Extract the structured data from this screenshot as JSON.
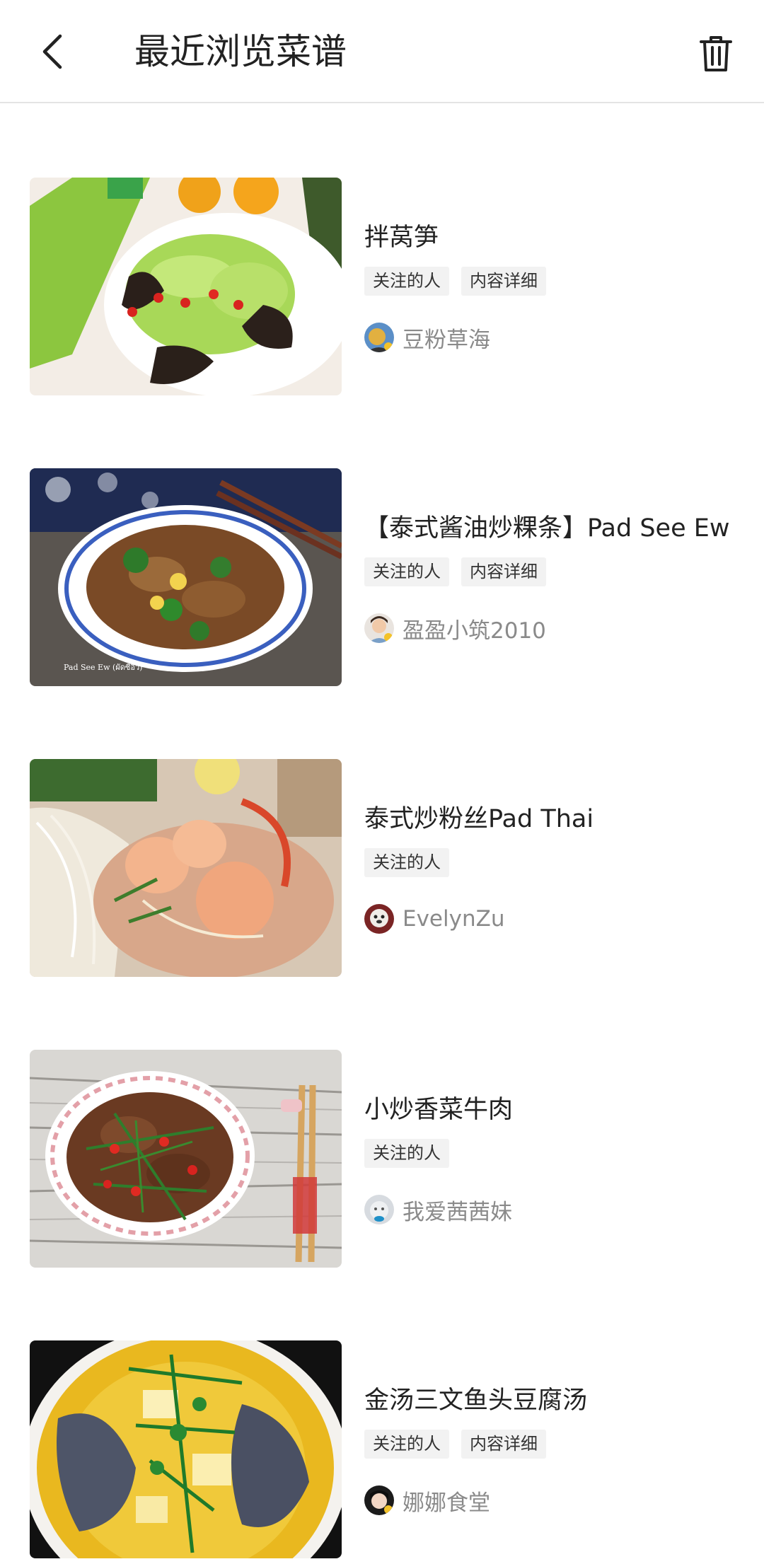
{
  "header": {
    "title": "最近浏览菜谱",
    "back_icon": "chevron-left-icon",
    "delete_icon": "trash-icon"
  },
  "recipes": [
    {
      "name": "拌莴笋",
      "tags": [
        "关注的人",
        "内容详细"
      ],
      "author": "豆粉草海",
      "image_alt": "lettuce salad with wood ear mushrooms and chili"
    },
    {
      "name": "【泰式酱油炒粿条】Pad See Ew",
      "tags": [
        "关注的人",
        "内容详细"
      ],
      "author": "盈盈小筑2010",
      "image_caption": "Pad See Ew (ผัดซีอิ๊ว)"
    },
    {
      "name": "泰式炒粉丝Pad Thai",
      "tags": [
        "关注的人"
      ],
      "author": "EvelynZu"
    },
    {
      "name": "小炒香菜牛肉",
      "tags": [
        "关注的人"
      ],
      "author": "我爱茜茜妹"
    },
    {
      "name": "金汤三文鱼头豆腐汤",
      "tags": [
        "关注的人",
        "内容详细"
      ],
      "author": "娜娜食堂"
    }
  ]
}
